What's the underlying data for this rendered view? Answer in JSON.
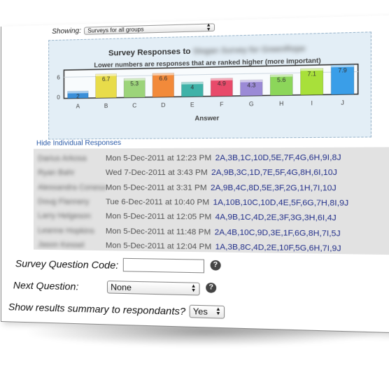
{
  "showing": {
    "label": "Showing:",
    "selected": "Surveys for all groups"
  },
  "chart_data": {
    "type": "bar",
    "title": "Survey Responses to",
    "title_blurred": "Slogan Survey for GreenRope",
    "subtitle": "Lower numbers are responses that are ranked higher (more important)",
    "categories": [
      "A",
      "B",
      "C",
      "D",
      "E",
      "F",
      "G",
      "H",
      "I",
      "J"
    ],
    "values": [
      2,
      6.7,
      5.3,
      6.6,
      4,
      4.9,
      4.3,
      5.6,
      7.1,
      7.9
    ],
    "value_labels": [
      "2",
      "6.7",
      "5.3",
      "6.6",
      "4",
      "4.9",
      "4.3",
      "5.6",
      "7.1",
      "7.9"
    ],
    "colors": [
      "#3a8fd9",
      "#e8dc4a",
      "#9cd47a",
      "#f28a3a",
      "#3fb2a8",
      "#e84a6a",
      "#9b8ad6",
      "#8cd65a",
      "#a8e03a",
      "#3a9ee8"
    ],
    "ylim": [
      0,
      8
    ],
    "yticks": [
      "6",
      "0"
    ],
    "xlabel": "Answer",
    "ylabel": ""
  },
  "hide_link": "Hide Individual Responses",
  "responses": [
    {
      "name": "Darius Arkosa",
      "date": "Mon 5-Dec-2011 at 12:23 PM",
      "answers": "2A,3B,1C,10D,5E,7F,4G,6H,9I,8J"
    },
    {
      "name": "Ryan Bahr",
      "date": "Wed 7-Dec-2011 at 3:43 PM",
      "answers": "2A,9B,3C,1D,7E,5F,4G,8H,6I,10J"
    },
    {
      "name": "Alessandra Conesa",
      "date": "Mon 5-Dec-2011 at 3:31 PM",
      "answers": "2A,9B,4C,8D,5E,3F,2G,1H,7I,10J"
    },
    {
      "name": "Doug Flannery",
      "date": "Tue 6-Dec-2011 at 10:40 PM",
      "answers": "1A,10B,10C,10D,4E,5F,6G,7H,8I,9J"
    },
    {
      "name": "Larry Helgeson",
      "date": "Mon 5-Dec-2011 at 12:05 PM",
      "answers": "4A,9B,1C,4D,2E,3F,3G,3H,6I,4J"
    },
    {
      "name": "Leanne Hopkins",
      "date": "Mon 5-Dec-2011 at 11:48 PM",
      "answers": "2A,4B,10C,9D,3E,1F,6G,8H,7I,5J"
    },
    {
      "name": "Jason Kessel",
      "date": "Mon 5-Dec-2011 at 12:04 PM",
      "answers": "1A,3B,8C,4D,2E,10F,5G,6H,7I,9J"
    }
  ],
  "form": {
    "code_label": "Survey Question Code:",
    "code_value": "",
    "next_label": "Next Question:",
    "next_value": "None",
    "summary_label": "Show results summary to respondants?",
    "summary_value": "Yes",
    "help_glyph": "?"
  }
}
